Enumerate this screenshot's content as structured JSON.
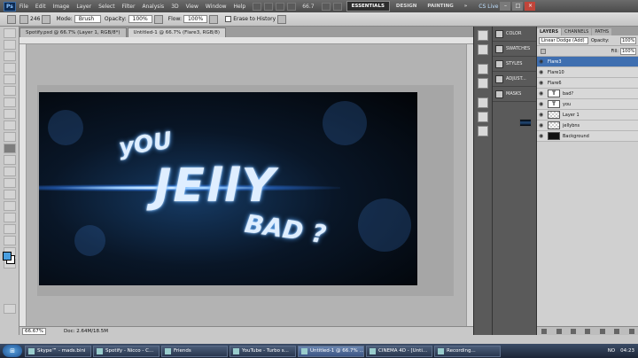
{
  "app": {
    "logo": "Ps"
  },
  "menubar": {
    "items": [
      "File",
      "Edit",
      "Image",
      "Layer",
      "Select",
      "Filter",
      "Analysis",
      "3D",
      "View",
      "Window",
      "Help"
    ],
    "zoom": "66.7",
    "workspaces": [
      "ESSENTIALS",
      "DESIGN",
      "PAINTING",
      "»"
    ],
    "cslive": "CS Live",
    "window_buttons": [
      "–",
      "□",
      "×"
    ]
  },
  "options": {
    "brush_size": "246",
    "mode_label": "Mode:",
    "mode_value": "Brush",
    "opacity_label": "Opacity:",
    "opacity_value": "100%",
    "flow_label": "Flow:",
    "flow_value": "100%",
    "erase_label": "Erase to History"
  },
  "documents": {
    "tabs": [
      "Spotify.psd @ 66.7% (Layer 1, RGB/8*)",
      "Untitled-1 @ 66.7% (Flare3, RGB/8)"
    ]
  },
  "artwork": {
    "word1": "yOU",
    "word2": "JEllY",
    "word3": "BAD ?"
  },
  "status": {
    "zoom": "66.67%",
    "doc": "Doc: 2.64M/18.5M"
  },
  "panels": {
    "adjust": [
      {
        "label": "COLOR"
      },
      {
        "label": "SWATCHES"
      },
      {
        "label": "STYLES"
      },
      {
        "label": "ADJUST..."
      },
      {
        "label": "MASKS"
      }
    ]
  },
  "layers": {
    "tabs": [
      "LAYERS",
      "CHANNELS",
      "PATHS"
    ],
    "blend_mode": "Linear Dodge (Add)",
    "opacity_label": "Opacity:",
    "opacity": "100%",
    "fill_label": "Fill:",
    "fill": "100%",
    "items": [
      {
        "name": "Flare3",
        "thumb": "flare",
        "selected": true
      },
      {
        "name": "Flare10",
        "thumb": "flare",
        "selected": false
      },
      {
        "name": "Flare6",
        "thumb": "flare",
        "selected": false
      },
      {
        "name": "bad?",
        "thumb": "text",
        "selected": false
      },
      {
        "name": "you",
        "thumb": "text",
        "selected": false
      },
      {
        "name": "Layer 1",
        "thumb": "check",
        "selected": false
      },
      {
        "name": "jellybns",
        "thumb": "check",
        "selected": false
      },
      {
        "name": "Background",
        "thumb": "dark",
        "selected": false
      }
    ]
  },
  "taskbar": {
    "items": [
      {
        "label": "Skype™ - mads.bini",
        "active": false
      },
      {
        "label": "Spotify - Nicco - C...",
        "active": false
      },
      {
        "label": "Friends",
        "active": false
      },
      {
        "label": "YouTube - Turbo s...",
        "active": false
      },
      {
        "label": "Untitled-1 @ 66.7% ...",
        "active": true
      },
      {
        "label": "CINEMA 4D - [Unti...",
        "active": false
      },
      {
        "label": "Recording...",
        "active": false
      }
    ],
    "lang": "NO",
    "clock": "04:23"
  }
}
